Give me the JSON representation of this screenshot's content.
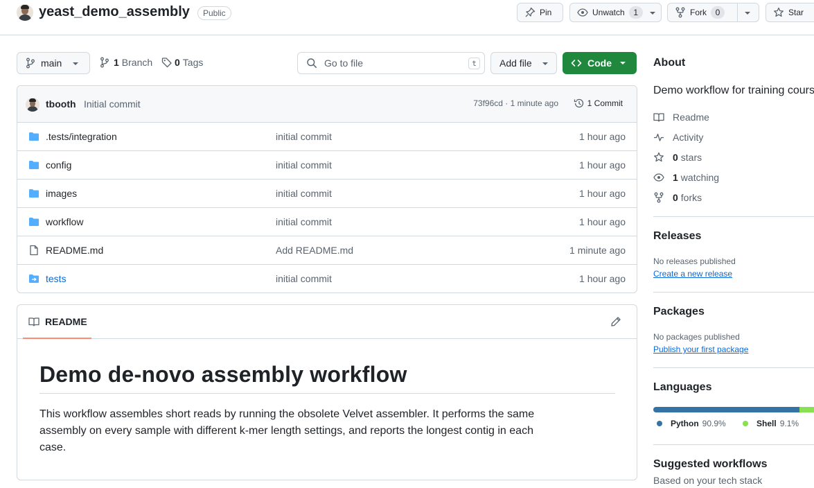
{
  "repo": {
    "name": "yeast_demo_assembly",
    "visibility": "Public"
  },
  "actions": {
    "pin_label": "Pin",
    "unwatch_label": "Unwatch",
    "watch_count": "1",
    "fork_label": "Fork",
    "fork_count": "0",
    "star_label": "Star"
  },
  "toolbar": {
    "branch": "main",
    "branch_count": "1",
    "branch_label": "Branch",
    "tag_count": "0",
    "tag_label": "Tags",
    "search_placeholder": "Go to file",
    "search_key": "t",
    "add_file_label": "Add file",
    "code_label": "Code"
  },
  "latest_commit": {
    "author": "tbooth",
    "message": "Initial commit",
    "hash_time": "73f96cd · 1 minute ago",
    "commits_label": "1 Commit"
  },
  "files": [
    {
      "name": ".tests/integration",
      "message": "initial commit",
      "time": "1 hour ago",
      "icon": "folder-icon"
    },
    {
      "name": "config",
      "message": "initial commit",
      "time": "1 hour ago",
      "icon": "folder-icon"
    },
    {
      "name": "images",
      "message": "initial commit",
      "time": "1 hour ago",
      "icon": "folder-icon"
    },
    {
      "name": "workflow",
      "message": "initial commit",
      "time": "1 hour ago",
      "icon": "folder-icon"
    },
    {
      "name": "README.md",
      "message": "Add README.md",
      "time": "1 minute ago",
      "icon": "file-icon"
    },
    {
      "name": "tests",
      "message": "initial commit",
      "time": "1 hour ago",
      "icon": "submodule-folder-icon"
    }
  ],
  "readme": {
    "tab_label": "README",
    "title": "Demo de-novo assembly workflow",
    "body": "This workflow assembles short reads by running the obsolete Velvet assembler. It performs the same assembly on every sample with different k-mer length settings, and reports the longest contig in each case."
  },
  "about": {
    "heading": "About",
    "description": "Demo workflow for training course",
    "readme_label": "Readme",
    "activity_label": "Activity",
    "stars_count": "0",
    "stars_label": "stars",
    "watching_count": "1",
    "watching_label": "watching",
    "forks_count": "0",
    "forks_label": "forks"
  },
  "releases": {
    "heading": "Releases",
    "empty": "No releases published",
    "link": "Create a new release"
  },
  "packages": {
    "heading": "Packages",
    "empty": "No packages published",
    "link": "Publish your first package"
  },
  "languages": {
    "heading": "Languages",
    "items": [
      {
        "name": "Python",
        "percent": "90.9%",
        "value": 90.9,
        "color": "#3572A5"
      },
      {
        "name": "Shell",
        "percent": "9.1%",
        "value": 9.1,
        "color": "#89e051"
      }
    ]
  },
  "suggested": {
    "heading": "Suggested workflows",
    "subtitle": "Based on your tech stack"
  }
}
